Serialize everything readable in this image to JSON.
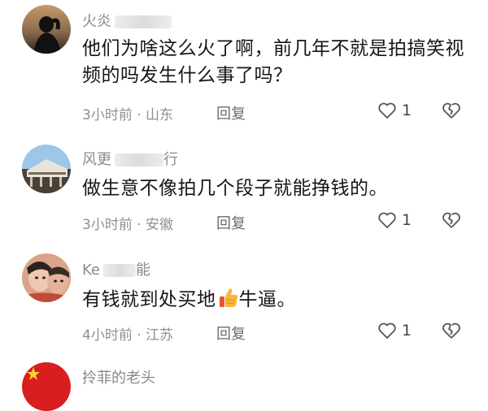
{
  "comments": [
    {
      "username": "火炎",
      "text": "他们为啥这么火了啊，前几年不就是拍搞笑视频的吗发生什么事了吗？",
      "time": "3小时前",
      "location": "山东",
      "reply_label": "回复",
      "likes": "1"
    },
    {
      "username": "风更",
      "username_tail": "行",
      "text": "做生意不像拍几个段子就能挣钱的。",
      "time": "3小时前",
      "location": "安徽",
      "reply_label": "回复",
      "likes": "1"
    },
    {
      "username": "Ke",
      "username_tail": "能",
      "text_before": "有钱就到处买地",
      "text_after": "牛逼。",
      "time": "4小时前",
      "location": "江苏",
      "reply_label": "回复",
      "likes": "1"
    },
    {
      "username": "拎菲的老头"
    }
  ],
  "colors": {
    "meta": "#8f8f8f",
    "text": "#161616",
    "username": "#8a8a8a"
  }
}
